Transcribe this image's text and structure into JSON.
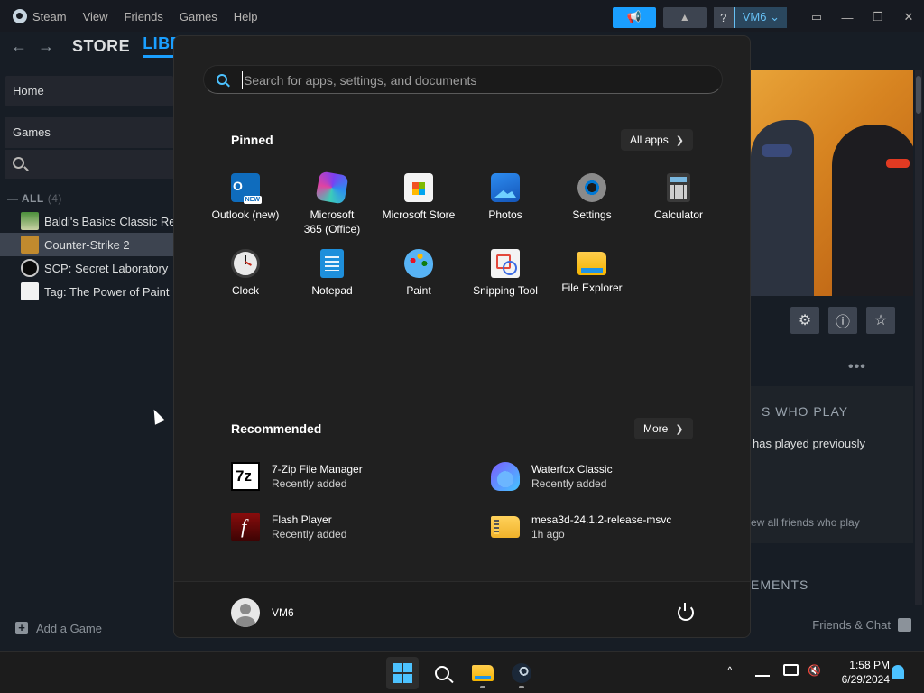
{
  "steam": {
    "menu": [
      "Steam",
      "View",
      "Friends",
      "Games",
      "Help"
    ],
    "help_label": "?",
    "user_label": "VM6 ⌄",
    "nav": {
      "back": "←",
      "forward": "→",
      "store": "STORE",
      "library": "LIBR"
    },
    "sidebar": {
      "home": "Home",
      "games": "Games",
      "all_label": "ALL",
      "all_count": "(4)",
      "games_list": [
        "Baldi's Basics Classic Re",
        "Counter-Strike 2",
        "SCP: Secret Laboratory",
        "Tag: The Power of Paint"
      ],
      "selected": "Counter-Strike 2",
      "add_game": "Add a Game"
    },
    "right_panel": {
      "friends_title": "S WHO PLAY",
      "friends_line": "has played previously",
      "friends_link": "ew all friends who play",
      "achievements_title": "EMENTS",
      "more_dots": "•••"
    },
    "friends_chat": "Friends & Chat"
  },
  "start_menu": {
    "search_placeholder": "Search for apps, settings, and documents",
    "pinned_title": "Pinned",
    "all_apps": "All apps",
    "pinned": [
      {
        "label": "Outlook (new)",
        "icon": "outlook-icon"
      },
      {
        "label": "Microsoft 365 (Office)",
        "icon": "microsoft-365-icon"
      },
      {
        "label": "Microsoft Store",
        "icon": "store-icon"
      },
      {
        "label": "Photos",
        "icon": "photos-icon"
      },
      {
        "label": "Settings",
        "icon": "settings-icon"
      },
      {
        "label": "Calculator",
        "icon": "calculator-icon"
      },
      {
        "label": "Clock",
        "icon": "clock-icon"
      },
      {
        "label": "Notepad",
        "icon": "notepad-icon"
      },
      {
        "label": "Paint",
        "icon": "paint-icon"
      },
      {
        "label": "Snipping Tool",
        "icon": "snipping-tool-icon"
      },
      {
        "label": "File Explorer",
        "icon": "file-explorer-icon"
      }
    ],
    "recommended_title": "Recommended",
    "more": "More",
    "recommended": [
      {
        "name": "7-Zip File Manager",
        "sub": "Recently added"
      },
      {
        "name": "Waterfox Classic",
        "sub": "Recently added"
      },
      {
        "name": "Flash Player",
        "sub": "Recently added"
      },
      {
        "name": "mesa3d-24.1.2-release-msvc",
        "sub": "1h ago"
      }
    ],
    "user": "VM6"
  },
  "taskbar": {
    "time": "1:58 PM",
    "date": "6/29/2024",
    "tray_chevron": "^"
  },
  "colors": {
    "steam_bg": "#171d25",
    "steam_accent": "#1a9fff",
    "start_bg": "#202020",
    "win_accent": "#4cc2ff"
  }
}
